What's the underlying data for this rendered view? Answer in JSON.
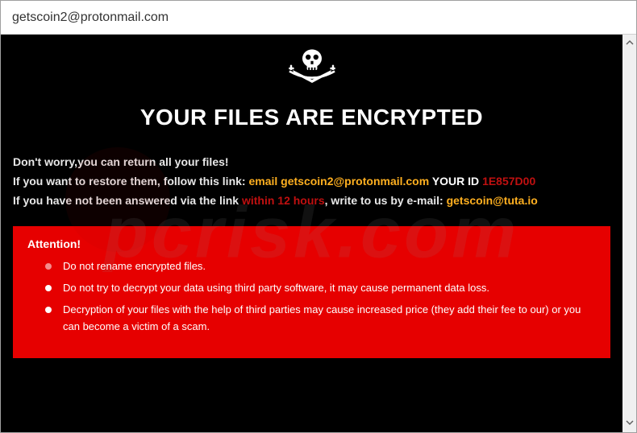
{
  "window": {
    "title": "getscoin2@protonmail.com"
  },
  "heading": "YOUR FILES ARE ENCRYPTED",
  "lines": {
    "l1": "Don't worry,you can return all your files!",
    "l2a": "If you want to restore them, follow this link: ",
    "l2_email_label": "email ",
    "l2_email": "getscoin2@protonmail.com",
    "l2_space": "   ",
    "l2_yourid_label": "YOUR ID ",
    "l2_yourid": "1E857D00",
    "l3a": "If you have not been answered via the link ",
    "l3_hours": "within 12 hours",
    "l3b": ", write to us by e-mail: ",
    "l3_email": "getscoin@tuta.io"
  },
  "attention": {
    "title": "Attention!",
    "items": [
      "Do not rename encrypted files.",
      "Do not try to decrypt your data using third party software, it may cause permanent data loss.",
      "Decryption of your files with the help of third parties may cause increased price (they add their fee to our) or you can become a victim of a scam."
    ]
  },
  "watermark": "pcrisk.com"
}
